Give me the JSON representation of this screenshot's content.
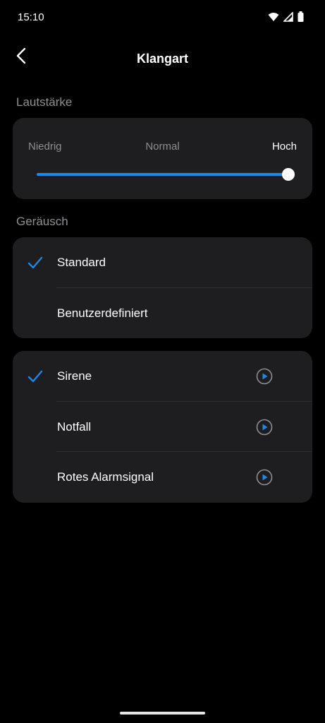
{
  "status_bar": {
    "time": "15:10"
  },
  "header": {
    "title": "Klangart"
  },
  "volume": {
    "section_label": "Lautstärke",
    "low_label": "Niedrig",
    "mid_label": "Normal",
    "high_label": "Hoch",
    "level": 1.0
  },
  "sound": {
    "section_label": "Geräusch",
    "options": [
      {
        "label": "Standard",
        "selected": true
      },
      {
        "label": "Benutzerdefiniert",
        "selected": false
      }
    ]
  },
  "tones": [
    {
      "label": "Sirene",
      "selected": true
    },
    {
      "label": "Notfall",
      "selected": false
    },
    {
      "label": "Rotes Alarmsignal",
      "selected": false
    }
  ],
  "colors": {
    "accent": "#1e88e5",
    "card": "#1e1e20",
    "background": "#000000"
  }
}
